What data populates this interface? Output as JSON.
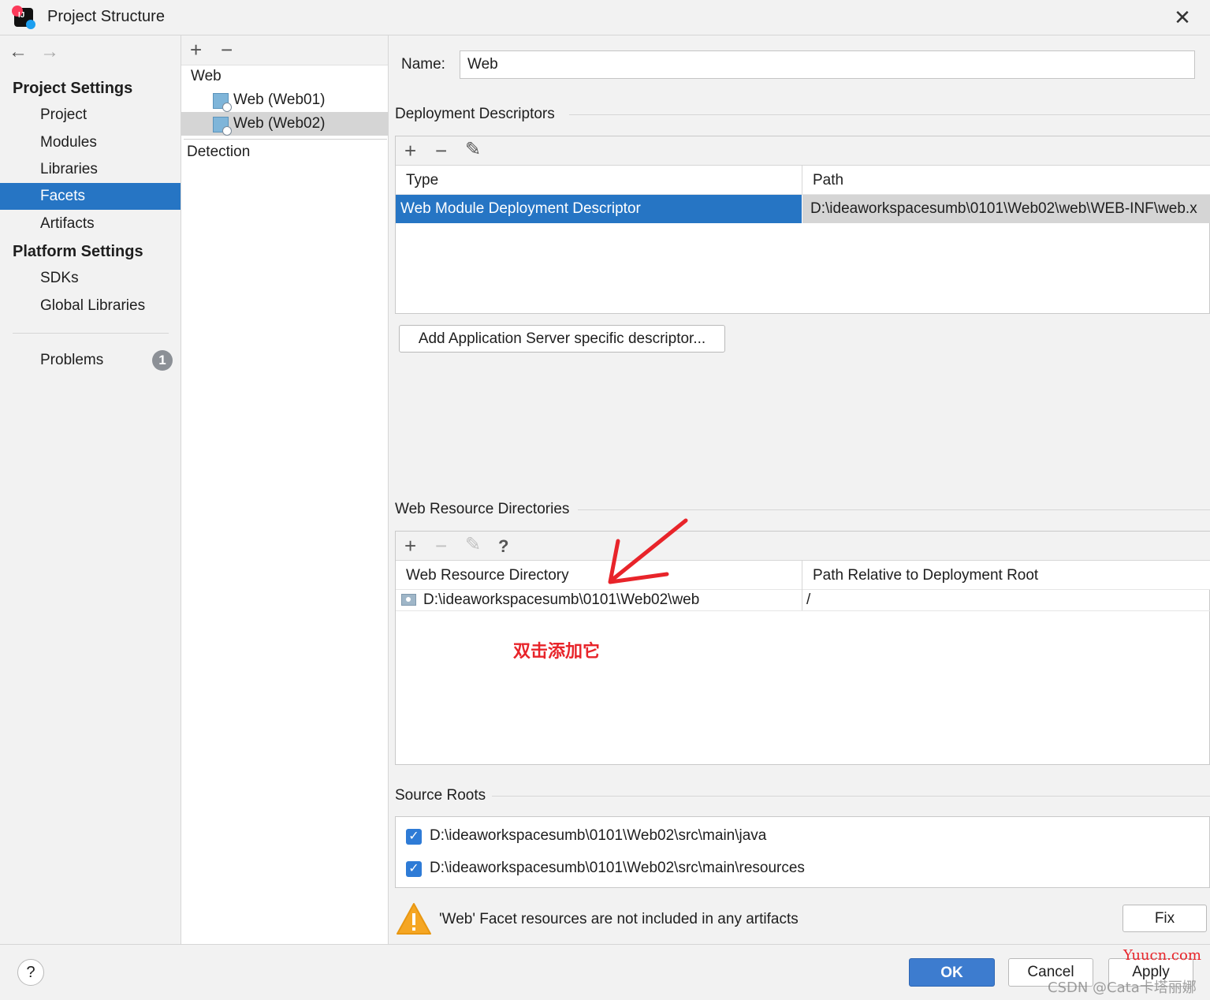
{
  "window": {
    "title": "Project Structure",
    "close": "✕"
  },
  "nav": {
    "back": "←",
    "forward": "→",
    "project_settings": "Project Settings",
    "items_project": [
      "Project",
      "Modules",
      "Libraries",
      "Facets",
      "Artifacts"
    ],
    "platform_settings": "Platform Settings",
    "items_platform": [
      "SDKs",
      "Global Libraries"
    ],
    "problems": "Problems",
    "problems_count": "1",
    "selected": "Facets"
  },
  "facets_list": {
    "add": "+",
    "remove": "−",
    "group": "Web",
    "children": [
      "Web (Web01)",
      "Web (Web02)"
    ],
    "detection": "Detection"
  },
  "detail": {
    "name_label": "Name:",
    "name_value": "Web",
    "deployment": {
      "title": "Deployment Descriptors",
      "toolbar": {
        "add": "+",
        "remove": "−",
        "edit": "✎"
      },
      "columns": [
        "Type",
        "Path"
      ],
      "rows": [
        {
          "type": "Web Module Deployment Descriptor",
          "path": "D:\\ideaworkspacesumb\\0101\\Web02\\web\\WEB-INF\\web.x"
        }
      ],
      "add_button": "Add Application Server specific descriptor..."
    },
    "web_resources": {
      "title": "Web Resource Directories",
      "toolbar": {
        "add": "+",
        "remove": "−",
        "edit": "✎",
        "help": "?"
      },
      "columns": [
        "Web Resource Directory",
        "Path Relative to Deployment Root"
      ],
      "rows": [
        {
          "dir": "D:\\ideaworkspacesumb\\0101\\Web02\\web",
          "rel": "/"
        }
      ],
      "annotation": "双击添加它",
      "annotation_color": "#e8242a"
    },
    "source_roots": {
      "title": "Source Roots",
      "items": [
        {
          "path": "D:\\ideaworkspacesumb\\0101\\Web02\\src\\main\\java",
          "checked": true
        },
        {
          "path": "D:\\ideaworkspacesumb\\0101\\Web02\\src\\main\\resources",
          "checked": true
        }
      ]
    },
    "warning": {
      "text": "'Web' Facet resources are not included in any artifacts",
      "fix": "Fix"
    }
  },
  "footer": {
    "help": "?",
    "ok": "OK",
    "cancel": "Cancel",
    "apply": "Apply"
  },
  "watermarks": {
    "site": "Yuucn.com",
    "csdn": "CSDN @Cata卡塔丽娜"
  },
  "colors": {
    "accent": "#2675c4",
    "ok_button": "#3d7ccf",
    "selection_gray": "#d5d5d5"
  }
}
